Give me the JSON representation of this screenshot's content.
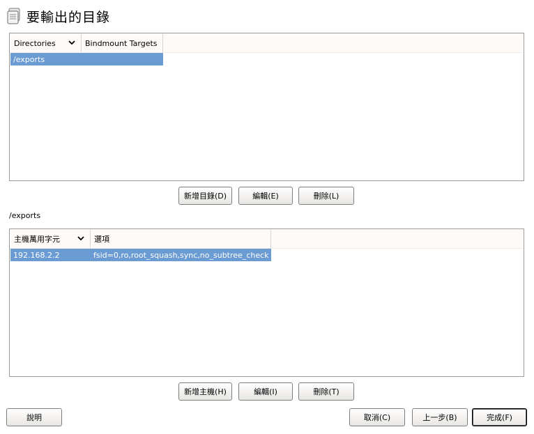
{
  "title": "要輸出的目錄",
  "directories_panel": {
    "columns": [
      "Directories",
      "Bindmount Targets"
    ],
    "rows": [
      {
        "directory": "/exports",
        "bindmount": ""
      }
    ]
  },
  "directory_buttons": {
    "add": "新增目錄(D)",
    "edit": "編輯(E)",
    "delete": "刪除(L)"
  },
  "selected_directory": "/exports",
  "hosts_panel": {
    "columns": [
      "主機萬用字元",
      "選項"
    ],
    "rows": [
      {
        "host": "192.168.2.2",
        "options": "fsid=0,ro,root_squash,sync,no_subtree_check"
      }
    ]
  },
  "host_buttons": {
    "add": "新增主機(H)",
    "edit": "編輯(I)",
    "delete": "刪除(T)"
  },
  "footer": {
    "help": "說明",
    "cancel": "取消(C)",
    "back": "上一步(B)",
    "finish": "完成(F)"
  },
  "colors": {
    "selection": "#6a9bd3",
    "header_bg": "#fdfaf7",
    "border": "#9a9a9a"
  },
  "icons": {
    "title": "folder-stack-icon",
    "sort": "chevron-down-icon"
  }
}
